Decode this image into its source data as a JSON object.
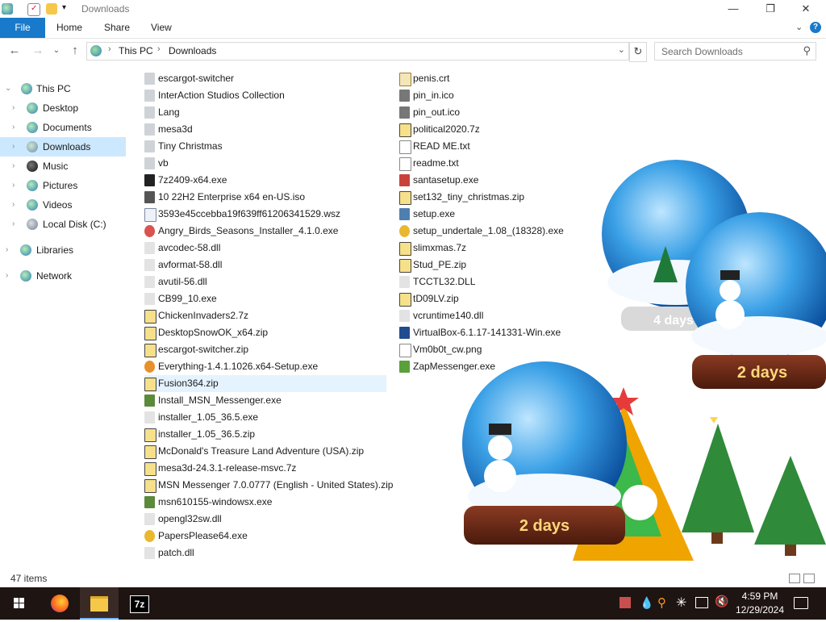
{
  "window": {
    "title": "Downloads",
    "buttons": {
      "minimize": "—",
      "maximize": "❐",
      "close": "✕"
    }
  },
  "ribbon": {
    "tabs": [
      "File",
      "Home",
      "Share",
      "View"
    ],
    "help": "?",
    "expand": "⌄"
  },
  "address": {
    "crumbs": [
      "This PC",
      "Downloads"
    ],
    "separator": "›"
  },
  "search": {
    "placeholder": "Search Downloads"
  },
  "nav": [
    {
      "label": "This PC",
      "icon": "computer-icon",
      "expanded": true
    },
    {
      "label": "Desktop",
      "icon": "desktop-icon"
    },
    {
      "label": "Documents",
      "icon": "documents-icon"
    },
    {
      "label": "Downloads",
      "icon": "downloads-icon",
      "selected": true
    },
    {
      "label": "Music",
      "icon": "music-icon"
    },
    {
      "label": "Pictures",
      "icon": "pictures-icon"
    },
    {
      "label": "Videos",
      "icon": "videos-icon"
    },
    {
      "label": "Local Disk (C:)",
      "icon": "drive-icon"
    },
    {
      "label": "Libraries",
      "icon": "libraries-icon"
    },
    {
      "label": "Network",
      "icon": "network-icon"
    }
  ],
  "files_col1": [
    {
      "name": "escargot-switcher",
      "type": "folder"
    },
    {
      "name": "InterAction Studios Collection",
      "type": "folder"
    },
    {
      "name": "Lang",
      "type": "folder"
    },
    {
      "name": "mesa3d",
      "type": "folder"
    },
    {
      "name": "Tiny Christmas",
      "type": "folder"
    },
    {
      "name": "vb",
      "type": "folder"
    },
    {
      "name": "7z2409-x64.exe",
      "type": "7z-exe"
    },
    {
      "name": "10 22H2 Enterprise x64 en-US.iso",
      "type": "iso"
    },
    {
      "name": "3593e45ccebba19f639ff61206341529.wsz",
      "type": "file"
    },
    {
      "name": "Angry_Birds_Seasons_Installer_4.1.0.exe",
      "type": "app"
    },
    {
      "name": "avcodec-58.dll",
      "type": "dll"
    },
    {
      "name": "avformat-58.dll",
      "type": "dll"
    },
    {
      "name": "avutil-56.dll",
      "type": "dll"
    },
    {
      "name": "CB99_10.exe",
      "type": "dll"
    },
    {
      "name": "ChickenInvaders2.7z",
      "type": "archive"
    },
    {
      "name": "DesktopSnowOK_x64.zip",
      "type": "archive"
    },
    {
      "name": "escargot-switcher.zip",
      "type": "archive"
    },
    {
      "name": "Everything-1.4.1.1026.x64-Setup.exe",
      "type": "search-app"
    },
    {
      "name": "Fusion364.zip",
      "type": "archive",
      "hover": true
    },
    {
      "name": "Install_MSN_Messenger.exe",
      "type": "installer"
    },
    {
      "name": "installer_1.05_36.5.exe",
      "type": "dll"
    },
    {
      "name": "installer_1.05_36.5.zip",
      "type": "archive"
    },
    {
      "name": "McDonald's Treasure Land Adventure (USA).zip",
      "type": "archive"
    },
    {
      "name": "mesa3d-24.3.1-release-msvc.7z",
      "type": "archive"
    },
    {
      "name": "MSN Messenger 7.0.0777 (English - United States).zip",
      "type": "archive"
    },
    {
      "name": "msn610155-windowsx.exe",
      "type": "installer"
    },
    {
      "name": "opengl32sw.dll",
      "type": "dll"
    },
    {
      "name": "PapersPlease64.exe",
      "type": "game"
    },
    {
      "name": "patch.dll",
      "type": "dll"
    }
  ],
  "files_col2": [
    {
      "name": "penis.crt",
      "type": "cert"
    },
    {
      "name": "pin_in.ico",
      "type": "ico"
    },
    {
      "name": "pin_out.ico",
      "type": "ico"
    },
    {
      "name": "political2020.7z",
      "type": "archive"
    },
    {
      "name": "READ ME.txt",
      "type": "text"
    },
    {
      "name": "readme.txt",
      "type": "text"
    },
    {
      "name": "santasetup.exe",
      "type": "app"
    },
    {
      "name": "set132_tiny_christmas.zip",
      "type": "archive"
    },
    {
      "name": "setup.exe",
      "type": "installer"
    },
    {
      "name": "setup_undertale_1.08_(18328).exe",
      "type": "game"
    },
    {
      "name": "slimxmas.7z",
      "type": "archive"
    },
    {
      "name": "Stud_PE.zip",
      "type": "archive"
    },
    {
      "name": "TCCTL32.DLL",
      "type": "dll"
    },
    {
      "name": "tD09LV.zip",
      "type": "archive"
    },
    {
      "name": "vcruntime140.dll",
      "type": "dll"
    },
    {
      "name": "VirtualBox-6.1.17-141331-Win.exe",
      "type": "vbox"
    },
    {
      "name": "Vm0b0t_cw.png",
      "type": "image"
    },
    {
      "name": "ZapMessenger.exe",
      "type": "app"
    }
  ],
  "status": {
    "items": "47 items"
  },
  "decor": {
    "globe1": "4 days",
    "globe2": "2 days",
    "globe3": "2 days"
  },
  "taskbar": {
    "apps": [
      "firefox-icon",
      "file-explorer-icon",
      "7zip-icon"
    ],
    "seven_zip": "7z",
    "time": "4:59 PM",
    "date": "12/29/2024"
  },
  "colors": {
    "accent": "#1979ca",
    "selected": "#cce8ff",
    "hover": "#e5f3ff",
    "taskbar": "#1e1412"
  }
}
